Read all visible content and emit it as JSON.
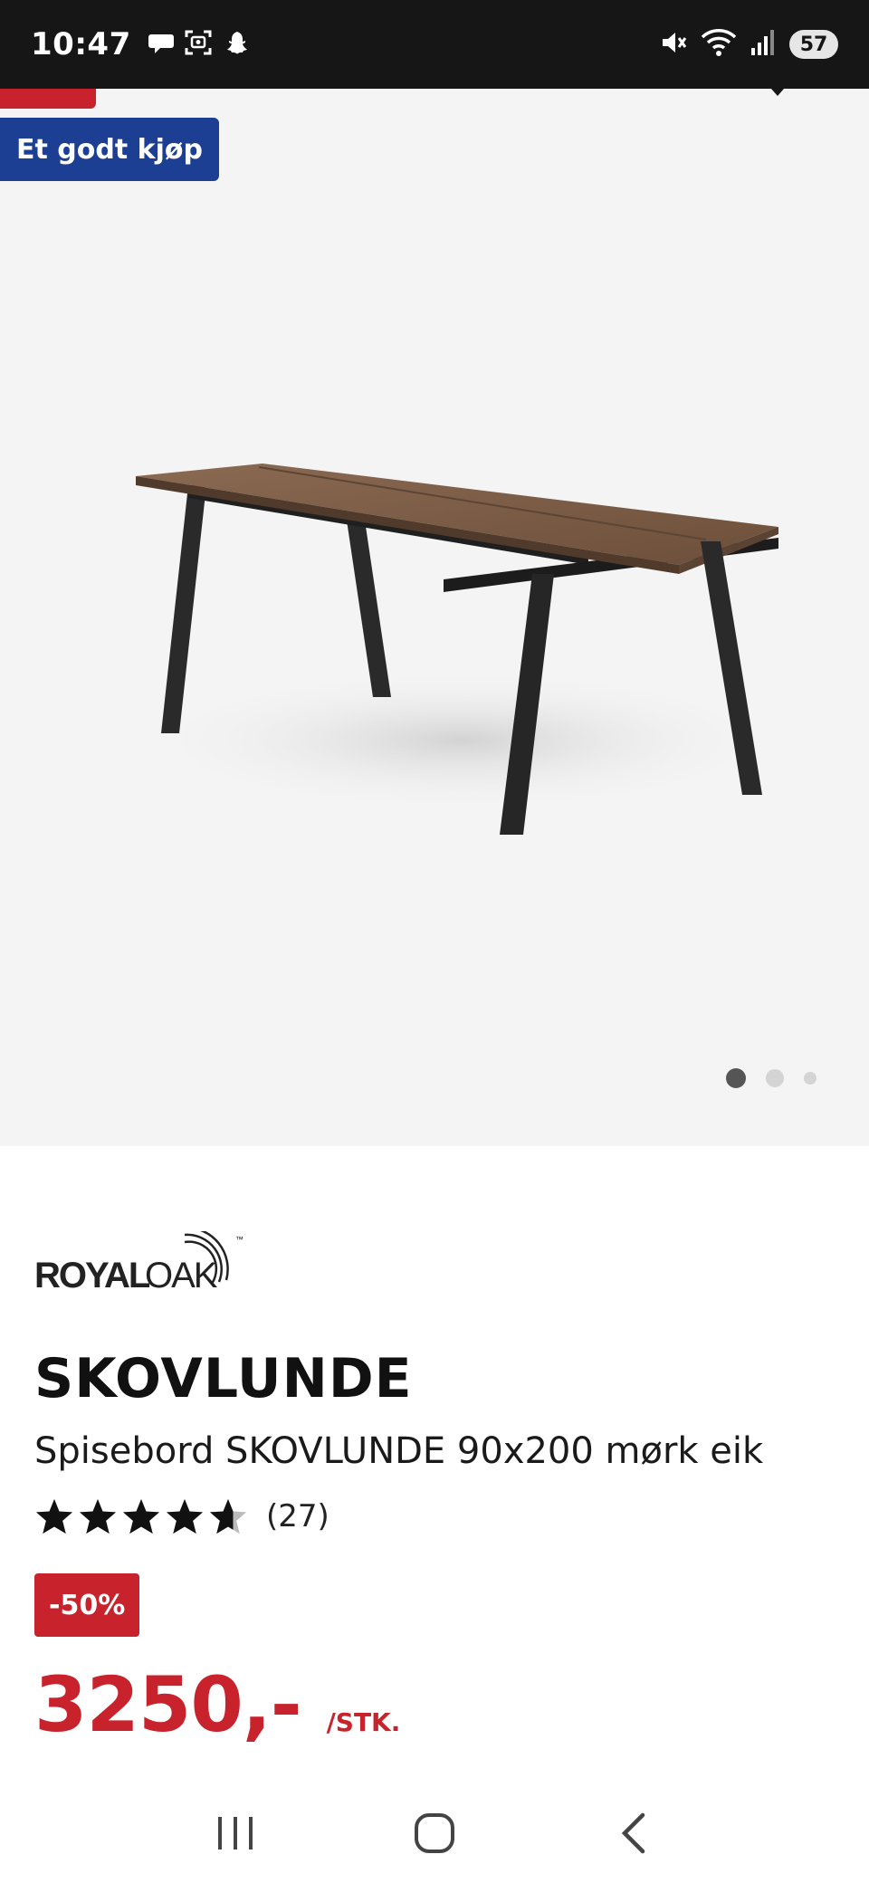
{
  "status_bar": {
    "time": "10:47",
    "battery": "57",
    "left_icons": [
      "chat-bubble-icon",
      "screenshot-icon",
      "snapchat-icon"
    ],
    "right_icons": [
      "mute-icon",
      "wifi-icon",
      "signal-icon",
      "battery-icon"
    ]
  },
  "gallery": {
    "badge": "Et godt kjøp",
    "badge_color": "#1c3f94",
    "tag_color": "#c8232c",
    "image_alt_icon": "dining-table-image",
    "dot_count": 3,
    "active_dot": 0
  },
  "product": {
    "brand": "ROYALOAK",
    "brand_bold": "ROYAL",
    "brand_light": "OAK",
    "brand_tm": "™",
    "name": "SKOVLUNDE",
    "description": "Spisebord SKOVLUNDE 90x200 mørk eik",
    "rating": 4.5,
    "rating_count": "(27)",
    "discount": "-50%",
    "price": "3250,-",
    "unit": "/STK.",
    "accent_color": "#c8232c"
  },
  "nav_bar": {
    "buttons": [
      "recent-apps-icon",
      "home-icon",
      "back-icon"
    ]
  }
}
